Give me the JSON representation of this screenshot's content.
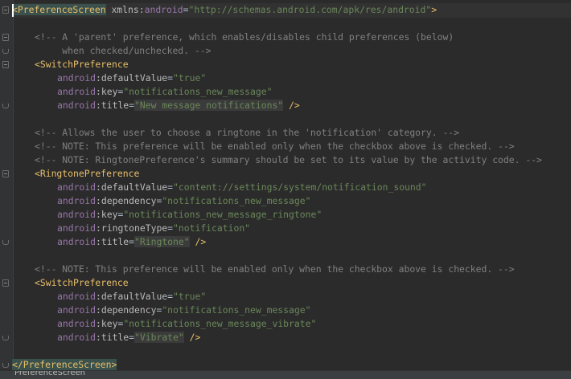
{
  "editor": {
    "lines": [
      {
        "indent": 0,
        "parts": [
          [
            "tag",
            "<PreferenceScreen"
          ],
          [
            "punct",
            " "
          ],
          [
            "attrname",
            "xmlns"
          ],
          [
            "punct",
            ":"
          ],
          [
            "ns",
            "android"
          ],
          [
            "punct",
            "="
          ],
          [
            "val",
            "\"http://schemas.android.com/apk/res/android\""
          ],
          [
            "tag",
            ">"
          ]
        ]
      },
      {
        "indent": 0,
        "parts": []
      },
      {
        "indent": 1,
        "parts": [
          [
            "cmt",
            "<!-- A 'parent' preference, which enables/disables child preferences (below)"
          ]
        ]
      },
      {
        "indent": 1,
        "parts": [
          [
            "cmt",
            "     when checked/unchecked. -->"
          ]
        ]
      },
      {
        "indent": 1,
        "parts": [
          [
            "tag",
            "<SwitchPreference"
          ]
        ]
      },
      {
        "indent": 2,
        "parts": [
          [
            "ns",
            "android"
          ],
          [
            "attrname",
            ":defaultValue"
          ],
          [
            "punct",
            "="
          ],
          [
            "val",
            "\"true\""
          ]
        ]
      },
      {
        "indent": 2,
        "parts": [
          [
            "ns",
            "android"
          ],
          [
            "attrname",
            ":key"
          ],
          [
            "punct",
            "="
          ],
          [
            "val",
            "\"notifications_new_message\""
          ]
        ]
      },
      {
        "indent": 2,
        "parts": [
          [
            "ns",
            "android"
          ],
          [
            "attrname",
            ":title"
          ],
          [
            "punct",
            "="
          ],
          [
            "val",
            "\"New message notifications\""
          ],
          [
            "punct",
            " "
          ],
          [
            "tag",
            "/>"
          ]
        ]
      },
      {
        "indent": 0,
        "parts": []
      },
      {
        "indent": 1,
        "parts": [
          [
            "cmt",
            "<!-- Allows the user to choose a ringtone in the 'notification' category. -->"
          ]
        ]
      },
      {
        "indent": 1,
        "parts": [
          [
            "cmt",
            "<!-- NOTE: This preference will be enabled only when the checkbox above is checked. -->"
          ]
        ]
      },
      {
        "indent": 1,
        "parts": [
          [
            "cmt",
            "<!-- NOTE: RingtonePreference's summary should be set to its value by the activity code. -->"
          ]
        ]
      },
      {
        "indent": 1,
        "parts": [
          [
            "tag",
            "<RingtonePreference"
          ]
        ]
      },
      {
        "indent": 2,
        "parts": [
          [
            "ns",
            "android"
          ],
          [
            "attrname",
            ":defaultValue"
          ],
          [
            "punct",
            "="
          ],
          [
            "val",
            "\"content://settings/system/notification_sound\""
          ]
        ]
      },
      {
        "indent": 2,
        "parts": [
          [
            "ns",
            "android"
          ],
          [
            "attrname",
            ":dependency"
          ],
          [
            "punct",
            "="
          ],
          [
            "val",
            "\"notifications_new_message\""
          ]
        ]
      },
      {
        "indent": 2,
        "parts": [
          [
            "ns",
            "android"
          ],
          [
            "attrname",
            ":key"
          ],
          [
            "punct",
            "="
          ],
          [
            "val",
            "\"notifications_new_message_ringtone\""
          ]
        ]
      },
      {
        "indent": 2,
        "parts": [
          [
            "ns",
            "android"
          ],
          [
            "attrname",
            ":ringtoneType"
          ],
          [
            "punct",
            "="
          ],
          [
            "val",
            "\"notification\""
          ]
        ]
      },
      {
        "indent": 2,
        "parts": [
          [
            "ns",
            "android"
          ],
          [
            "attrname",
            ":title"
          ],
          [
            "punct",
            "="
          ],
          [
            "val",
            "\"Ringtone\""
          ],
          [
            "punct",
            " "
          ],
          [
            "tag",
            "/>"
          ]
        ]
      },
      {
        "indent": 0,
        "parts": []
      },
      {
        "indent": 1,
        "parts": [
          [
            "cmt",
            "<!-- NOTE: This preference will be enabled only when the checkbox above is checked. -->"
          ]
        ]
      },
      {
        "indent": 1,
        "parts": [
          [
            "tag",
            "<SwitchPreference"
          ]
        ]
      },
      {
        "indent": 2,
        "parts": [
          [
            "ns",
            "android"
          ],
          [
            "attrname",
            ":defaultValue"
          ],
          [
            "punct",
            "="
          ],
          [
            "val",
            "\"true\""
          ]
        ]
      },
      {
        "indent": 2,
        "parts": [
          [
            "ns",
            "android"
          ],
          [
            "attrname",
            ":dependency"
          ],
          [
            "punct",
            "="
          ],
          [
            "val",
            "\"notifications_new_message\""
          ]
        ]
      },
      {
        "indent": 2,
        "parts": [
          [
            "ns",
            "android"
          ],
          [
            "attrname",
            ":key"
          ],
          [
            "punct",
            "="
          ],
          [
            "val",
            "\"notifications_new_message_vibrate\""
          ]
        ]
      },
      {
        "indent": 2,
        "parts": [
          [
            "ns",
            "android"
          ],
          [
            "attrname",
            ":title"
          ],
          [
            "punct",
            "="
          ],
          [
            "val",
            "\"Vibrate\""
          ],
          [
            "punct",
            " "
          ],
          [
            "tag",
            "/>"
          ]
        ]
      },
      {
        "indent": 0,
        "parts": []
      },
      {
        "indent": 0,
        "parts": [
          [
            "tag",
            "</PreferenceScreen>"
          ]
        ]
      }
    ],
    "folds": [
      {
        "line": 0,
        "kind": "start"
      },
      {
        "line": 2,
        "kind": "start"
      },
      {
        "line": 3,
        "kind": "end"
      },
      {
        "line": 4,
        "kind": "start"
      },
      {
        "line": 7,
        "kind": "end"
      },
      {
        "line": 12,
        "kind": "start"
      },
      {
        "line": 17,
        "kind": "end"
      },
      {
        "line": 20,
        "kind": "start"
      },
      {
        "line": 24,
        "kind": "end"
      },
      {
        "line": 26,
        "kind": "end"
      }
    ]
  },
  "breadcrumb": {
    "label": "PreferenceScreen"
  },
  "colors": {
    "background": "#2b2b2b",
    "tag": "#e8bf6a",
    "namespace": "#9876aa",
    "value": "#6a8759",
    "comment": "#808080"
  }
}
